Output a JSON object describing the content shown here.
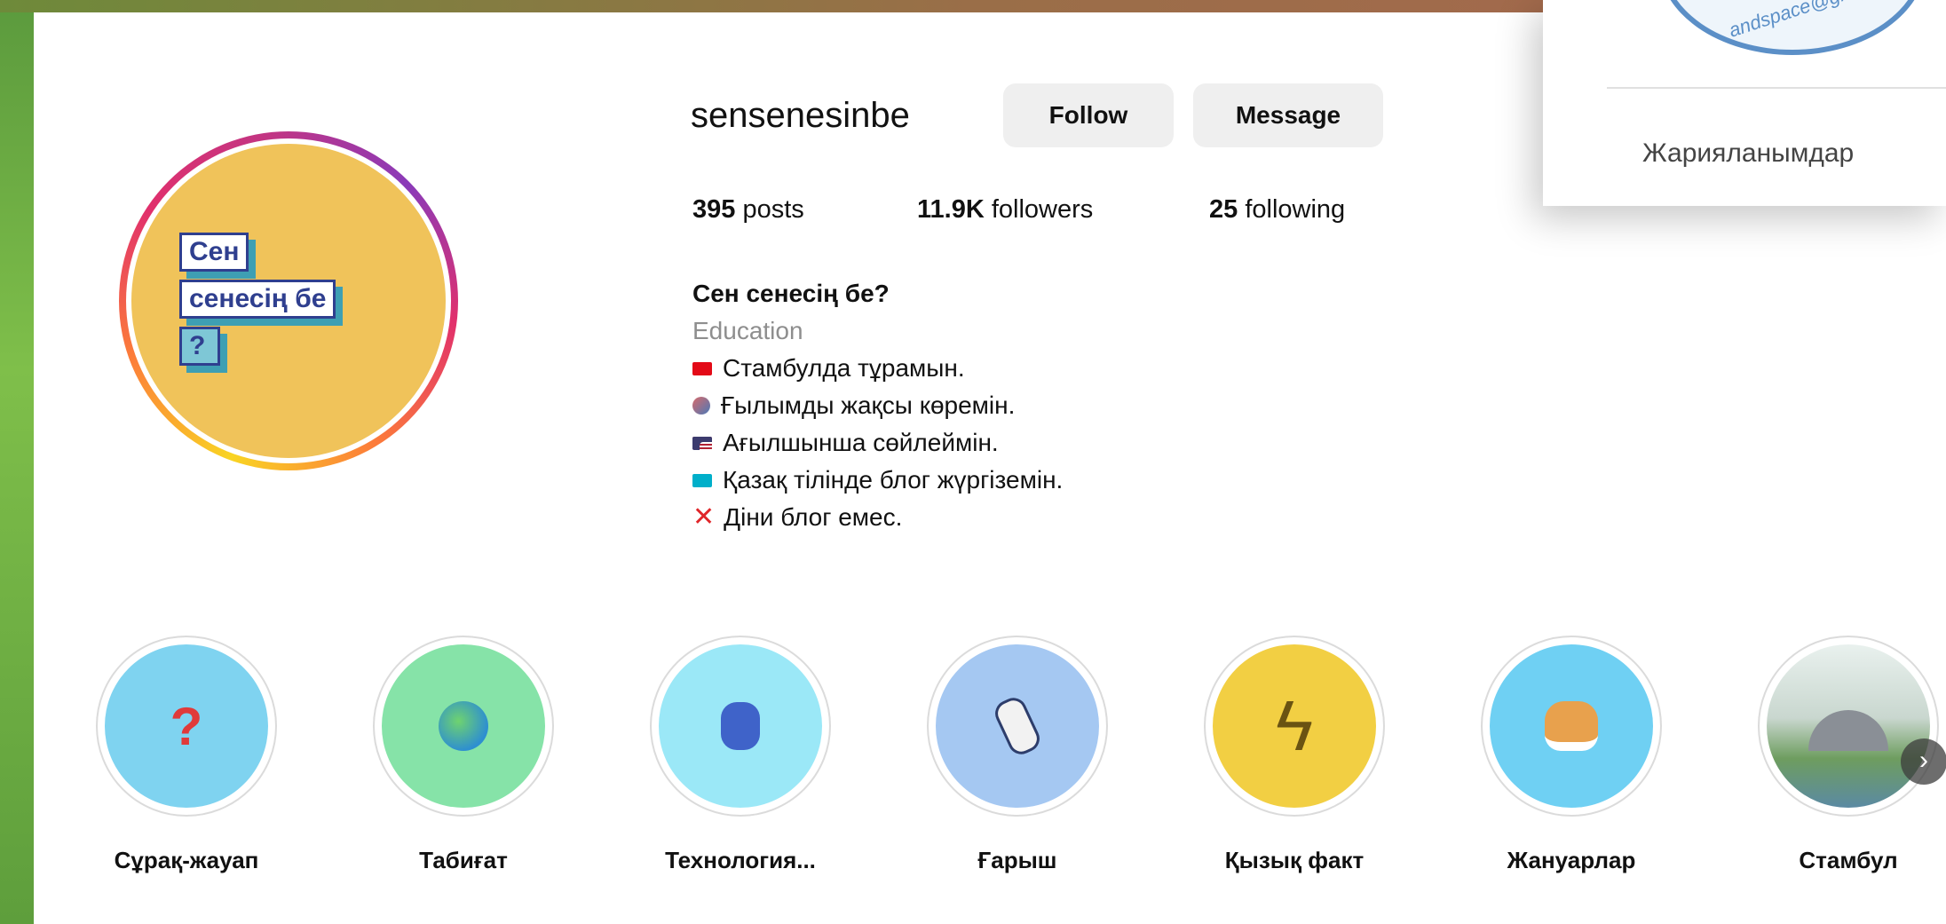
{
  "profile": {
    "username": "sensenesinbe",
    "follow_label": "Follow",
    "message_label": "Message",
    "stats": {
      "posts_count": "395",
      "posts_label": "posts",
      "followers_count": "11.9K",
      "followers_label": "followers",
      "following_count": "25",
      "following_label": "following"
    },
    "avatar_logo": {
      "line1": "Сен",
      "line2": "сенесің бе",
      "line3": "?"
    },
    "bio": {
      "name": "Сен сенесің бе?",
      "category": "Education",
      "lines": [
        {
          "flag": "turkey-flag-icon",
          "text": "Стамбулда тұрамын."
        },
        {
          "flag": "scientist-icon",
          "text": "Ғылымды жақсы көремін."
        },
        {
          "flag": "usa-flag-icon",
          "text": "Ағылшынша сөйлеймін."
        },
        {
          "flag": "kazakhstan-flag-icon",
          "text": "Қазақ тілінде блог жүргіземін."
        },
        {
          "flag": "cross-mark-icon",
          "text": "Діни блог емес."
        }
      ]
    }
  },
  "highlights": [
    {
      "label": "Сұрақ-жауап",
      "icon": "astronaut-question-icon",
      "color": "#7fd3f0"
    },
    {
      "label": "Табиғат",
      "icon": "earth-globe-icon",
      "color": "#86e3a8"
    },
    {
      "label": "Технология...",
      "icon": "robot-icon",
      "color": "#9be8f7"
    },
    {
      "label": "Ғарыш",
      "icon": "astronaut-rocket-icon",
      "color": "#a5c8f2"
    },
    {
      "label": "Қызық факт",
      "icon": "lightning-icon",
      "color": "#f2cf43"
    },
    {
      "label": "Жануарлар",
      "icon": "shiba-dog-icon",
      "color": "#6fd0f3"
    },
    {
      "label": "Стамбул",
      "icon": "mosque-painting-icon",
      "color": "#dde9e2"
    }
  ],
  "popup": {
    "stamp_text": "andspace@gmail",
    "link_label": "Жарияланымдар"
  },
  "colors": {
    "button_bg": "#efefef",
    "stamp_blue": "#5b8fc7",
    "logo_navy": "#2f3f8f",
    "avatar_yellow": "#f0c35a"
  }
}
